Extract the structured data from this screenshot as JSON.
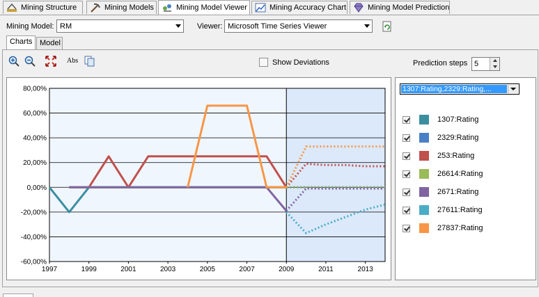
{
  "tabs": [
    {
      "label": "Mining Structure",
      "icon": "mining-structure-icon"
    },
    {
      "label": "Mining Models",
      "icon": "pickaxe-icon"
    },
    {
      "label": "Mining Model Viewer",
      "icon": "model-viewer-icon",
      "active": true
    },
    {
      "label": "Mining Accuracy Chart",
      "icon": "accuracy-chart-icon"
    },
    {
      "label": "Mining Model Prediction",
      "icon": "diamond-icon"
    }
  ],
  "toolbar": {
    "mining_model_label": "Mining Model:",
    "mining_model_value": "RM",
    "viewer_label": "Viewer:",
    "viewer_value": "Microsoft Time Series Viewer"
  },
  "inner_tabs": [
    {
      "label": "Charts",
      "active": true
    },
    {
      "label": "Model"
    }
  ],
  "chart_toolbar": {
    "show_deviations_label": "Show Deviations",
    "show_deviations_checked": false,
    "prediction_steps_label": "Prediction steps",
    "prediction_steps_value": "5",
    "abs_label": "Abs"
  },
  "series_dropdown": "1307:Rating,2329:Rating,...",
  "chart_data": {
    "type": "line",
    "x": [
      1997,
      1998,
      1999,
      2000,
      2001,
      2002,
      2003,
      2004,
      2005,
      2006,
      2007,
      2008,
      2009,
      2010,
      2011,
      2012,
      2013,
      2014
    ],
    "x_ticks": [
      "1997",
      "1999",
      "2001",
      "2003",
      "2005",
      "2007",
      "2009",
      "2011",
      "2013"
    ],
    "y_ticks": [
      "80,00%",
      "60,00%",
      "40,00%",
      "20,00%",
      "0,00%",
      "-20,00%",
      "-40,00%",
      "-60,00%"
    ],
    "ylim": [
      -60,
      80
    ],
    "forecast_start": 2009,
    "grid": true,
    "series": [
      {
        "name": "1307:Rating",
        "color": "#3a8ea0",
        "values": [
          0,
          -20,
          0,
          0,
          0,
          0,
          0,
          0,
          0,
          0,
          0,
          0,
          0,
          0,
          0,
          0,
          0,
          0
        ]
      },
      {
        "name": "2329:Rating",
        "color": "#4a7fc7",
        "values": [
          null,
          0,
          0,
          0,
          0,
          0,
          0,
          0,
          0,
          0,
          0,
          0,
          0,
          0,
          0,
          0,
          0,
          0
        ]
      },
      {
        "name": "253:Rating",
        "color": "#c0504d",
        "values": [
          null,
          0,
          0,
          25,
          0,
          25,
          25,
          25,
          25,
          25,
          25,
          25,
          0,
          19,
          18,
          18,
          17,
          17
        ]
      },
      {
        "name": "26614:Rating",
        "color": "#9bbb59",
        "values": [
          null,
          0,
          0,
          0,
          0,
          0,
          0,
          0,
          0,
          0,
          0,
          0,
          0,
          0,
          0,
          0,
          0,
          0
        ]
      },
      {
        "name": "2671:Rating",
        "color": "#8064a2",
        "values": [
          null,
          0,
          0,
          0,
          0,
          0,
          0,
          0,
          0,
          0,
          0,
          0,
          -19,
          -1,
          -1,
          -1,
          -1,
          -1
        ]
      },
      {
        "name": "27611:Rating",
        "color": "#4bacc6",
        "values": [
          null,
          null,
          null,
          null,
          null,
          null,
          null,
          null,
          null,
          null,
          null,
          null,
          -20,
          -37,
          -30,
          -24,
          -18,
          -14
        ]
      },
      {
        "name": "27837:Rating",
        "color": "#f79646",
        "values": [
          null,
          null,
          null,
          null,
          null,
          null,
          null,
          0,
          66,
          66,
          66,
          0,
          0,
          33,
          33,
          33,
          33,
          33
        ]
      }
    ]
  },
  "legend": [
    {
      "label": "1307:Rating",
      "color": "#3a8ea0",
      "checked": true
    },
    {
      "label": "2329:Rating",
      "color": "#4a7fc7",
      "checked": true
    },
    {
      "label": "253:Rating",
      "color": "#c0504d",
      "checked": true
    },
    {
      "label": "26614:Rating",
      "color": "#9bbb59",
      "checked": true
    },
    {
      "label": "2671:Rating",
      "color": "#8064a2",
      "checked": true
    },
    {
      "label": "27611:Rating",
      "color": "#4bacc6",
      "checked": true
    },
    {
      "label": "27837:Rating",
      "color": "#f79646",
      "checked": true
    }
  ]
}
